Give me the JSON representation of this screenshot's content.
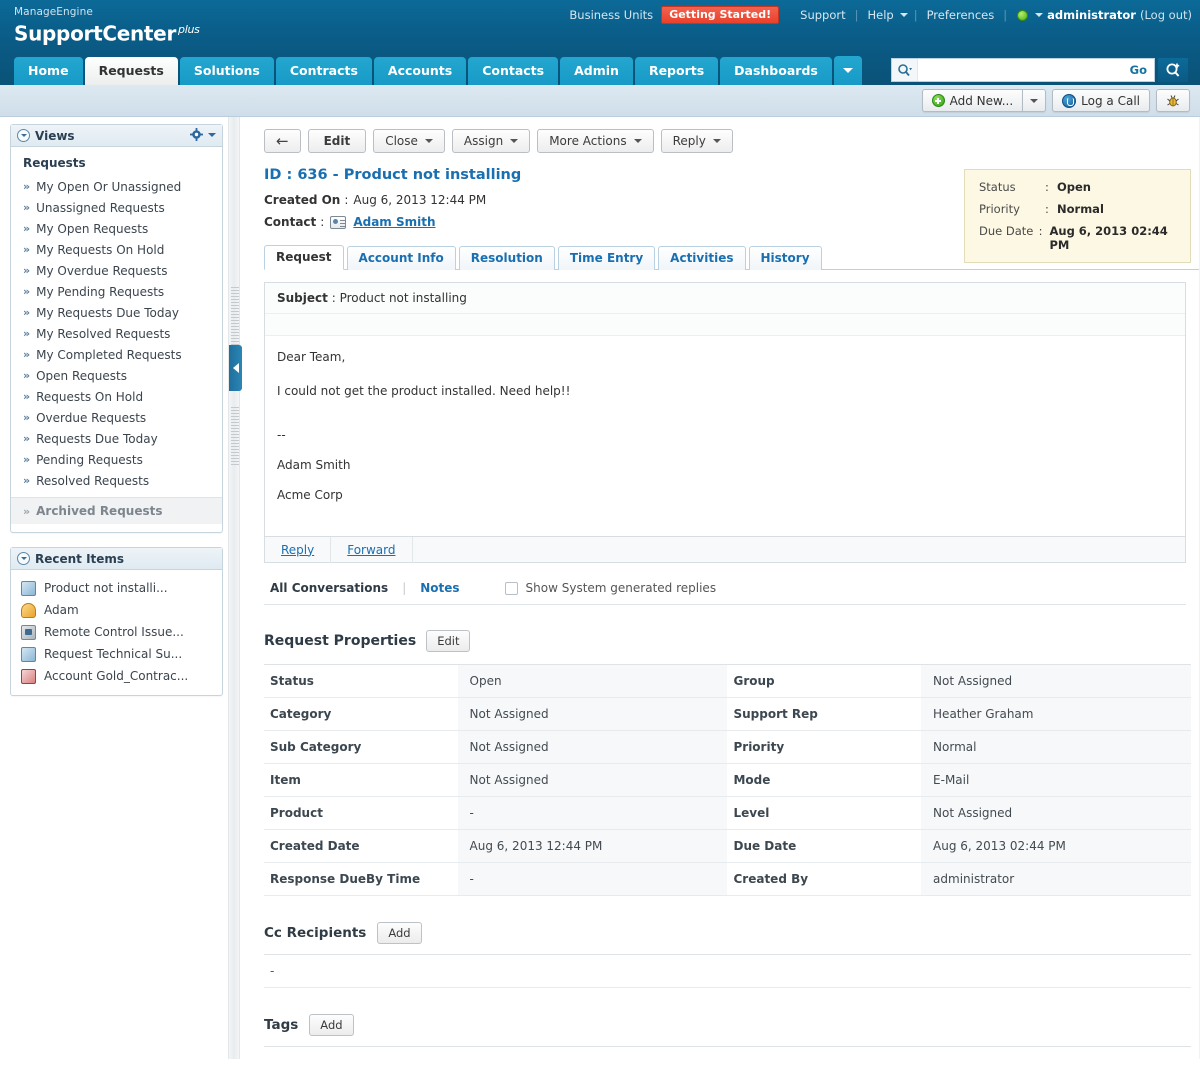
{
  "header": {
    "brand_top": "ManageEngine",
    "brand_main": "SupportCenter",
    "brand_sup": "plus",
    "business_units": "Business Units",
    "getting_started": "Getting Started!",
    "support": "Support",
    "help": "Help",
    "preferences": "Preferences",
    "user": "administrator",
    "logout": "(Log out)",
    "sep": "|"
  },
  "nav": {
    "tabs": [
      {
        "label": "Home",
        "active": false
      },
      {
        "label": "Requests",
        "active": true
      },
      {
        "label": "Solutions",
        "active": false
      },
      {
        "label": "Contracts",
        "active": false
      },
      {
        "label": "Accounts",
        "active": false
      },
      {
        "label": "Contacts",
        "active": false
      },
      {
        "label": "Admin",
        "active": false
      },
      {
        "label": "Reports",
        "active": false
      },
      {
        "label": "Dashboards",
        "active": false
      }
    ],
    "more_tab": "",
    "search_value": "",
    "search_placeholder": "",
    "go_label": "Go"
  },
  "subtoolbar": {
    "add_new": "Add New...",
    "log_a_call": "Log a Call"
  },
  "sidebar": {
    "views_panel": {
      "title": "Views",
      "section_title": "Requests",
      "items": [
        {
          "label": "My Open Or Unassigned"
        },
        {
          "label": "Unassigned Requests"
        },
        {
          "label": "My Open Requests"
        },
        {
          "label": "My Requests On Hold"
        },
        {
          "label": "My Overdue Requests"
        },
        {
          "label": "My Pending Requests"
        },
        {
          "label": "My Requests Due Today"
        },
        {
          "label": "My Resolved Requests"
        },
        {
          "label": "My Completed Requests"
        },
        {
          "label": "Open Requests"
        },
        {
          "label": "Requests On Hold"
        },
        {
          "label": "Overdue Requests"
        },
        {
          "label": "Requests Due Today"
        },
        {
          "label": "Pending Requests"
        },
        {
          "label": "Resolved Requests"
        }
      ],
      "archived": "Archived Requests"
    },
    "recent_panel": {
      "title": "Recent Items",
      "items": [
        {
          "label": "Product not installi...",
          "icon": "request-doc-icon"
        },
        {
          "label": "Adam",
          "icon": "contact-user-icon"
        },
        {
          "label": "Remote Control Issue...",
          "icon": "monitor-icon"
        },
        {
          "label": "Request Technical Su...",
          "icon": "request-doc-icon"
        },
        {
          "label": "Account Gold_Contrac...",
          "icon": "contract-icon"
        }
      ]
    }
  },
  "toolbar": {
    "back": "←",
    "edit": "Edit",
    "close": "Close",
    "assign": "Assign",
    "more_actions": "More Actions",
    "reply": "Reply"
  },
  "request": {
    "title": "ID : 636 - Product not installing",
    "created_on_label": "Created On",
    "created_on_value": "Aug 6, 2013 12:44 PM",
    "contact_label": "Contact",
    "contact_name": "Adam Smith",
    "colon": ":",
    "status_card": [
      {
        "key": "Status",
        "value": "Open"
      },
      {
        "key": "Priority",
        "value": "Normal"
      },
      {
        "key": "Due Date",
        "value": "Aug 6, 2013 02:44 PM"
      }
    ],
    "tabs": [
      {
        "label": "Request",
        "active": true
      },
      {
        "label": "Account Info",
        "active": false
      },
      {
        "label": "Resolution",
        "active": false
      },
      {
        "label": "Time Entry",
        "active": false
      },
      {
        "label": "Activities",
        "active": false
      },
      {
        "label": "History",
        "active": false
      }
    ],
    "description": {
      "subject_label": "Subject",
      "subject_value": "Product not installing",
      "greeting": "Dear Team,",
      "body": "I could not get the product installed. Need help!!",
      "sign_dashes": "--",
      "sign_name": "Adam Smith",
      "sign_org": "Acme Corp",
      "reply": "Reply",
      "forward": "Forward"
    },
    "conversations": {
      "all_conversations": "All Conversations",
      "notes": "Notes",
      "show_system": "Show System generated replies"
    },
    "properties": {
      "heading": "Request Properties",
      "edit": "Edit",
      "rows": [
        {
          "k1": "Status",
          "v1": "Open",
          "k2": "Group",
          "v2": "Not Assigned"
        },
        {
          "k1": "Category",
          "v1": "Not Assigned",
          "k2": "Support Rep",
          "v2": "Heather Graham"
        },
        {
          "k1": "Sub Category",
          "v1": "Not Assigned",
          "k2": "Priority",
          "v2": "Normal"
        },
        {
          "k1": "Item",
          "v1": "Not Assigned",
          "k2": "Mode",
          "v2": "E-Mail"
        },
        {
          "k1": "Product",
          "v1": "-",
          "k2": "Level",
          "v2": "Not Assigned"
        },
        {
          "k1": "Created Date",
          "v1": "Aug 6, 2013 12:44 PM",
          "k2": "Due Date",
          "v2": "Aug 6, 2013 02:44 PM"
        },
        {
          "k1": "Response DueBy Time",
          "v1": "-",
          "k2": "Created By",
          "v2": "administrator"
        }
      ]
    },
    "cc_recipients": {
      "heading": "Cc Recipients",
      "add": "Add",
      "value": "-"
    },
    "tags": {
      "heading": "Tags",
      "add": "Add"
    }
  },
  "colors": {
    "header_blue": "#0a5f8a",
    "tab_blue": "#1a9bc7",
    "link_blue": "#1a6fb0",
    "status_card_bg": "#fcf8e3",
    "badge_red": "#e8412b",
    "accent_green": "#49b018"
  }
}
